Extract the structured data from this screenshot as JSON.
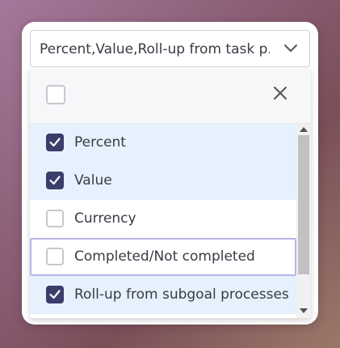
{
  "select": {
    "value": "Percent,Value,Roll-up from task p...",
    "icon": "chevron-down-icon"
  },
  "dropdown": {
    "select_all_icon": "checkbox-icon",
    "close_icon": "close-icon",
    "options": [
      {
        "label": "Percent",
        "checked": true
      },
      {
        "label": "Value",
        "checked": true
      },
      {
        "label": "Currency",
        "checked": false
      },
      {
        "label": "Completed/Not completed",
        "checked": false
      },
      {
        "label": "Roll-up from subgoal processes",
        "checked": true
      }
    ]
  },
  "colors": {
    "checked": "#3b3d6b",
    "selected_row": "#e5f1fc",
    "focus_border": "#b7b5e8"
  }
}
